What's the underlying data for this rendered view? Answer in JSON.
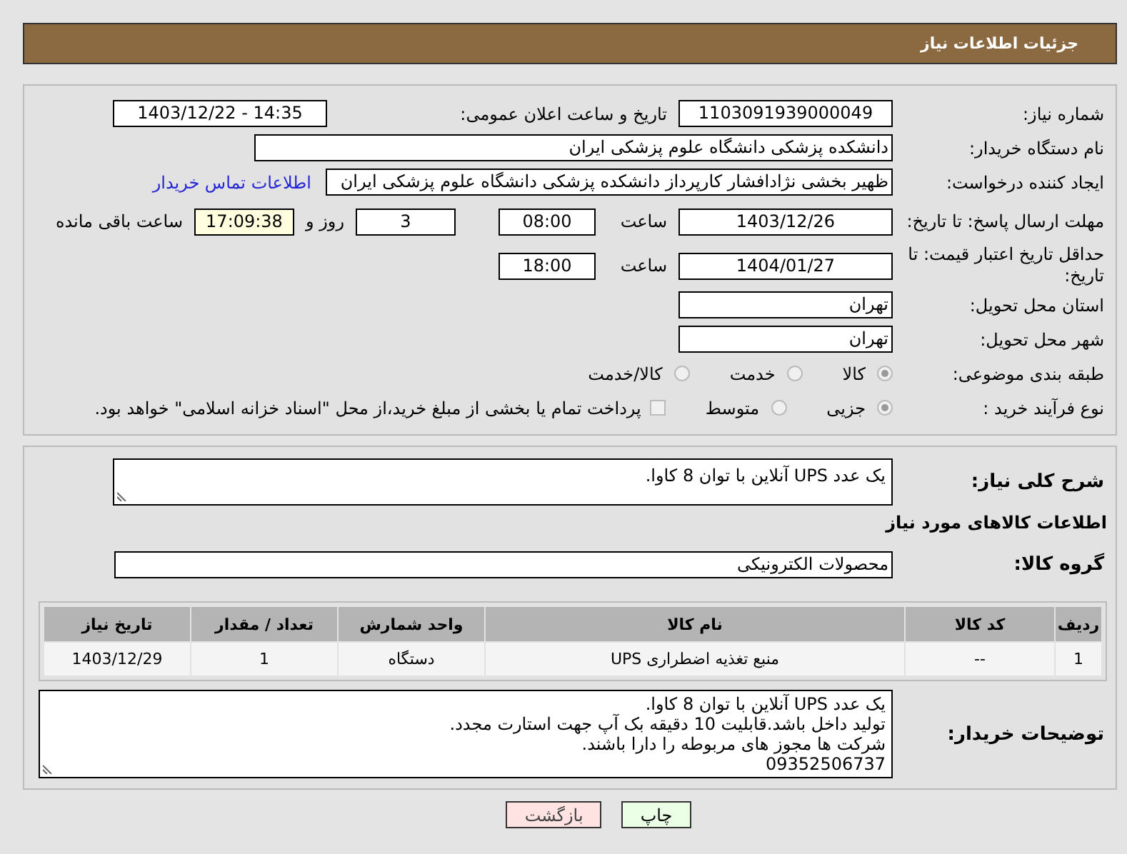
{
  "header": {
    "title": "جزئیات اطلاعات نیاز"
  },
  "need_number": {
    "label": "شماره نیاز:",
    "value": "1103091939000049"
  },
  "announce": {
    "label": "تاریخ و ساعت اعلان عمومی:",
    "value": "1403/12/22 - 14:35"
  },
  "buyer_org": {
    "label": "نام دستگاه خریدار:",
    "value": "دانشکده پزشکی دانشگاه علوم پزشکی ایران"
  },
  "requester": {
    "label": "ایجاد کننده درخواست:",
    "value": "ظهیر بخشی نژادافشار کارپرداز دانشکده پزشکی دانشگاه علوم پزشکی ایران",
    "link": "اطلاعات تماس خریدار"
  },
  "reply_deadline": {
    "label": "مهلت ارسال پاسخ: تا تاریخ:",
    "date": "1403/12/26",
    "time_label": "ساعت",
    "time": "08:00",
    "days": "3",
    "days_label": "روز و",
    "remaining": "17:09:38",
    "remaining_label": "ساعت باقی مانده"
  },
  "price_validity": {
    "label": "حداقل تاریخ اعتبار قیمت: تا تاریخ:",
    "date": "1404/01/27",
    "time_label": "ساعت",
    "time": "18:00"
  },
  "province": {
    "label": "استان محل تحویل:",
    "value": "تهران"
  },
  "city": {
    "label": "شهر محل تحویل:",
    "value": "تهران"
  },
  "category": {
    "label": "طبقه بندی موضوعی:",
    "options": [
      {
        "label": "کالا",
        "selected": true
      },
      {
        "label": "خدمت",
        "selected": false
      },
      {
        "label": "کالا/خدمت",
        "selected": false
      }
    ]
  },
  "purchase_type": {
    "label": "نوع فرآیند خرید :",
    "options": [
      {
        "label": "جزیی",
        "selected": true
      },
      {
        "label": "متوسط",
        "selected": false
      }
    ],
    "payment": {
      "label": "پرداخت تمام یا بخشی از مبلغ خرید،از محل \"اسناد خزانه اسلامی\" خواهد بود.",
      "checked": false
    }
  },
  "description": {
    "label": "شرح کلی نیاز:",
    "value": "یک عدد UPS آنلاین با توان 8 کاوا."
  },
  "goods_title": "اطلاعات کالاهای مورد نیاز",
  "goods_group": {
    "label": "گروه کالا:",
    "value": "محصولات الکترونیکی"
  },
  "table": {
    "columns": [
      "ردیف",
      "کد کالا",
      "نام کالا",
      "واحد شمارش",
      "تعداد / مقدار",
      "تاریخ نیاز"
    ],
    "rows": [
      [
        "1",
        "--",
        "منبع تغذیه اضطراری UPS",
        "دستگاه",
        "1",
        "1403/12/29"
      ]
    ]
  },
  "buyer_notes": {
    "label": "توضیحات خریدار:",
    "value": "یک عدد UPS آنلاین با توان 8 کاوا.\nتولید داخل باشد.قابلیت 10 دقیقه بک آپ جهت استارت مجدد.\nشرکت ها مجوز های مربوطه را دارا باشند.\n09352506737"
  },
  "buttons": [
    {
      "label": "چاپ",
      "kind": "print"
    },
    {
      "label": "بازگشت",
      "kind": "back"
    }
  ]
}
